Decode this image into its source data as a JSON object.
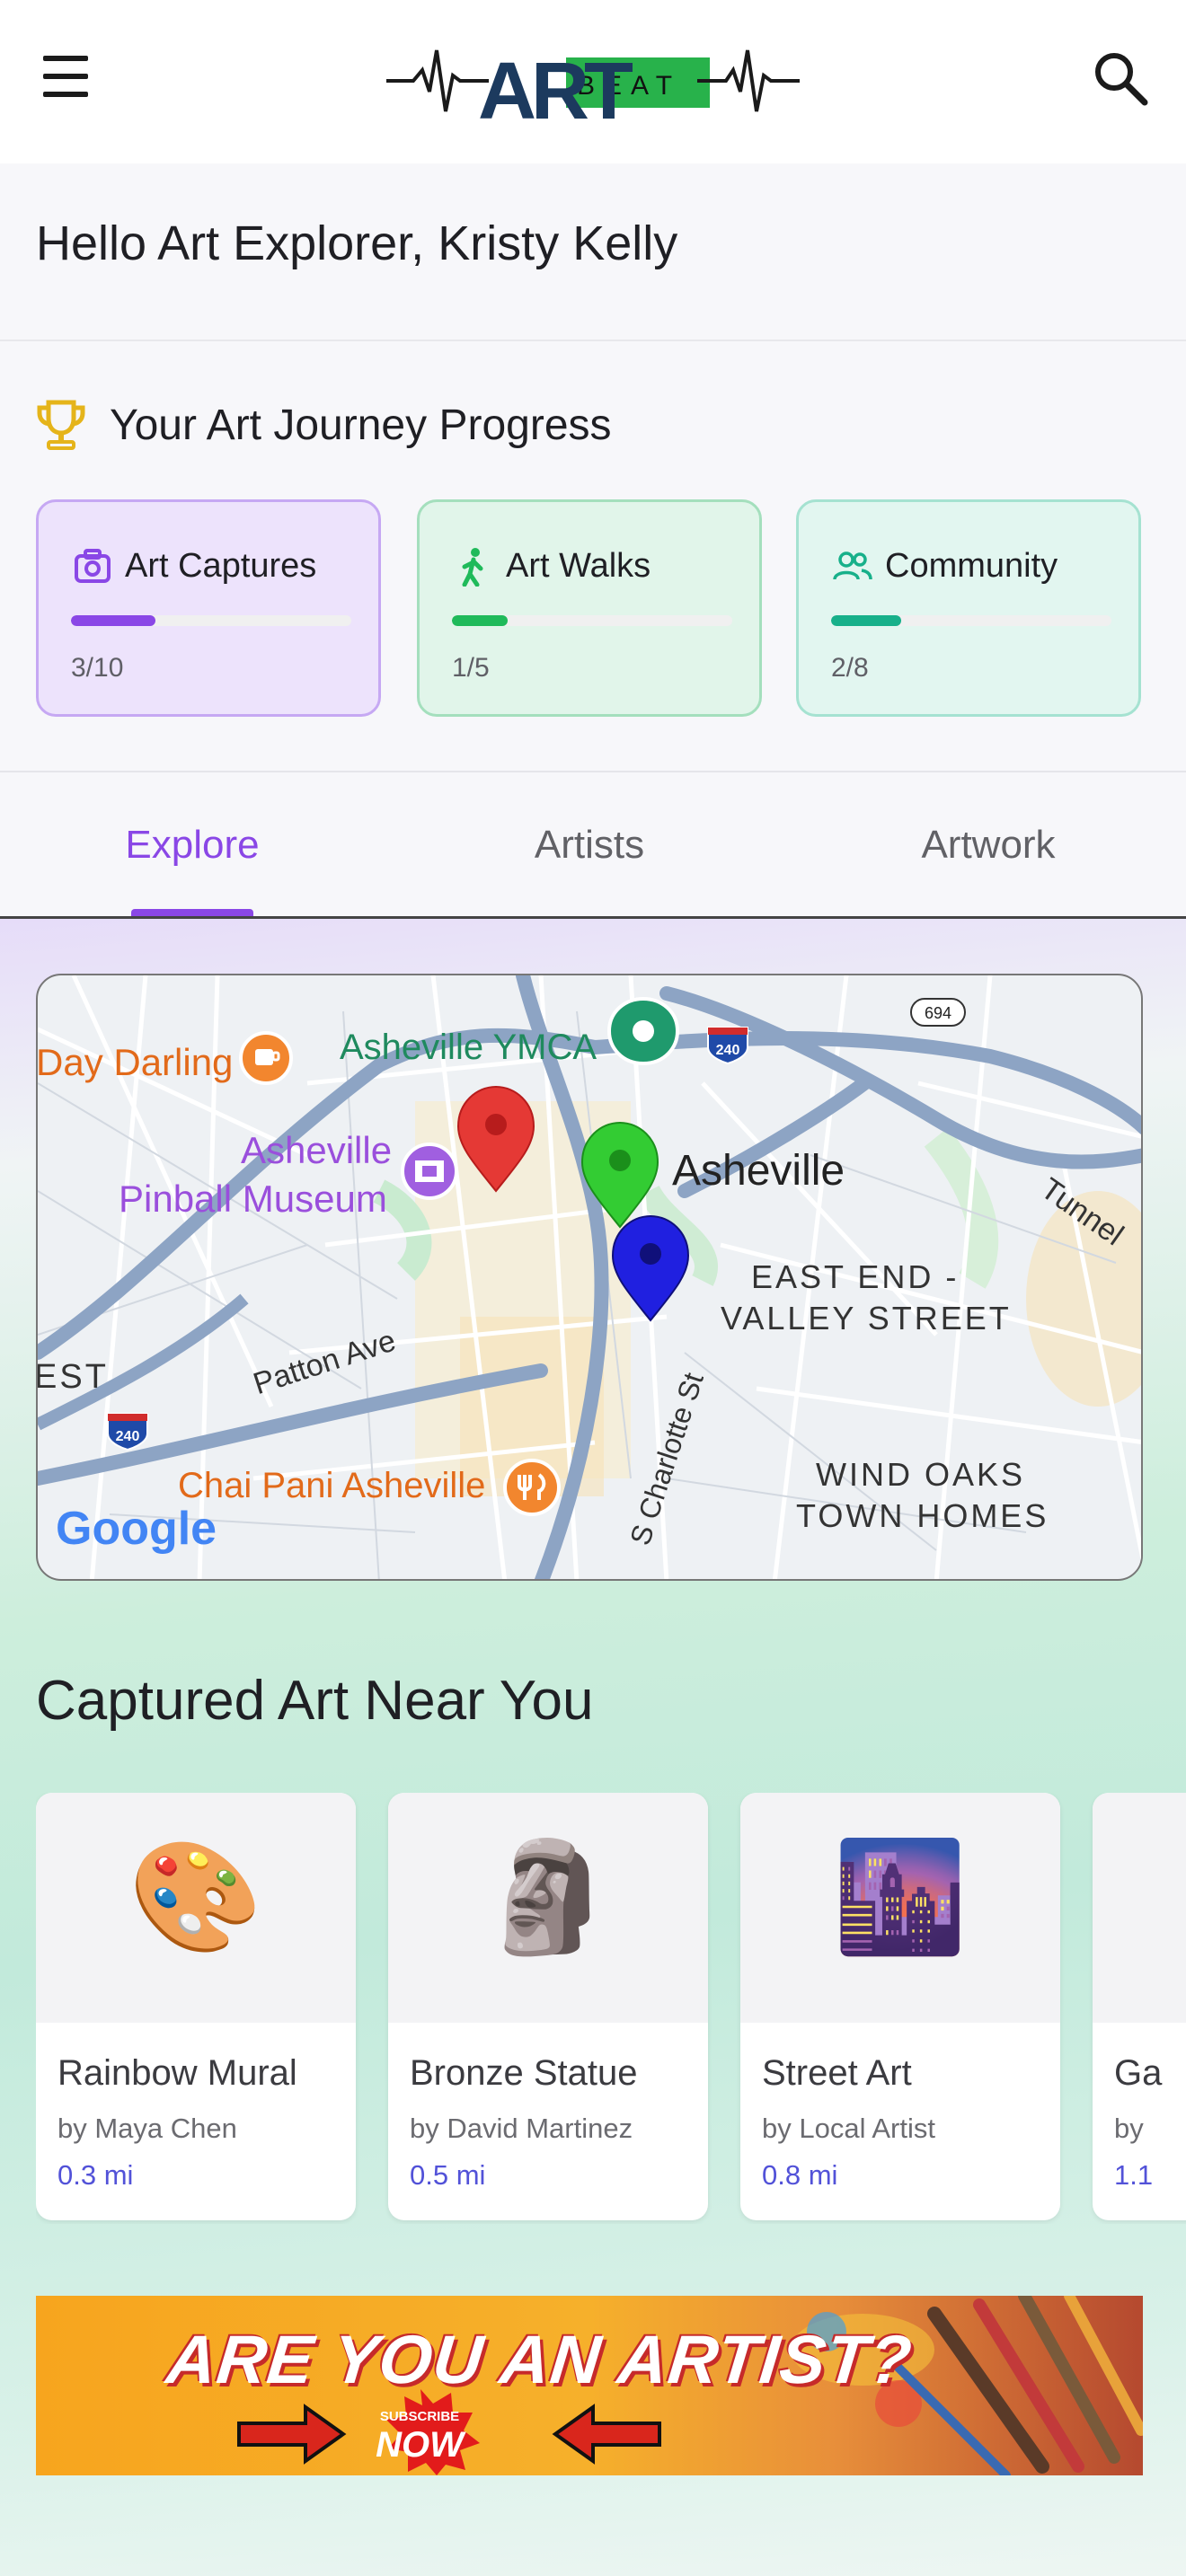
{
  "app": {
    "logo_art": "ART",
    "logo_beat": "BEAT",
    "menu_icon": "hamburger-menu-icon",
    "search_icon": "search-icon"
  },
  "greeting": "Hello Art Explorer, Kristy Kelly",
  "progress": {
    "title": "Your Art Journey Progress",
    "icon": "trophy-icon",
    "cards": [
      {
        "label": "Art Captures",
        "count": "3/10",
        "fraction": 0.3,
        "icon": "camera-icon",
        "color": "#8a47e6"
      },
      {
        "label": "Art Walks",
        "count": "1/5",
        "fraction": 0.2,
        "icon": "walking-person-icon",
        "color": "#1fba5a"
      },
      {
        "label": "Community",
        "count": "2/8",
        "fraction": 0.25,
        "icon": "people-icon",
        "color": "#17b08a"
      }
    ]
  },
  "tabs": [
    {
      "label": "Explore",
      "active": true
    },
    {
      "label": "Artists",
      "active": false
    },
    {
      "label": "Artwork",
      "active": false
    }
  ],
  "map": {
    "labels": {
      "day_darling": "Day Darling",
      "ymca": "Asheville YMCA",
      "pinball_1": "Asheville",
      "pinball_2": "Pinball Museum",
      "city": "Asheville",
      "east_end_1": "EAST END -",
      "east_end_2": "VALLEY STREET",
      "tunnel": "Tunnel",
      "patton": "Patton Ave",
      "est": "EST",
      "charlotte": "S Charlotte St",
      "chai_pani": "Chai Pani Asheville",
      "wind_oaks_1": "WIND OAKS",
      "wind_oaks_2": "TOWN HOMES",
      "google": "Google",
      "shield_240a": "240",
      "shield_240b": "240",
      "shield_694": "694"
    },
    "markers": [
      {
        "name": "red",
        "color": "#e53935"
      },
      {
        "name": "green",
        "color": "#33cc33"
      },
      {
        "name": "blue",
        "color": "#2020e0"
      }
    ]
  },
  "captured": {
    "title": "Captured Art Near You",
    "items": [
      {
        "emoji": "🎨",
        "title": "Rainbow Mural",
        "artist": "by Maya Chen",
        "distance": "0.3 mi"
      },
      {
        "emoji": "🗿",
        "title": "Bronze Statue",
        "artist": "by David Martinez",
        "distance": "0.5 mi"
      },
      {
        "emoji": "🌆",
        "title": "Street Art",
        "artist": "by Local Artist",
        "distance": "0.8 mi"
      },
      {
        "emoji": "",
        "title": "Ga",
        "artist": "by",
        "distance": "1.1"
      }
    ]
  },
  "banner": {
    "headline": "ARE YOU AN ARTIST?",
    "subscribe": "SUBSCRIBE",
    "now": "NOW"
  }
}
